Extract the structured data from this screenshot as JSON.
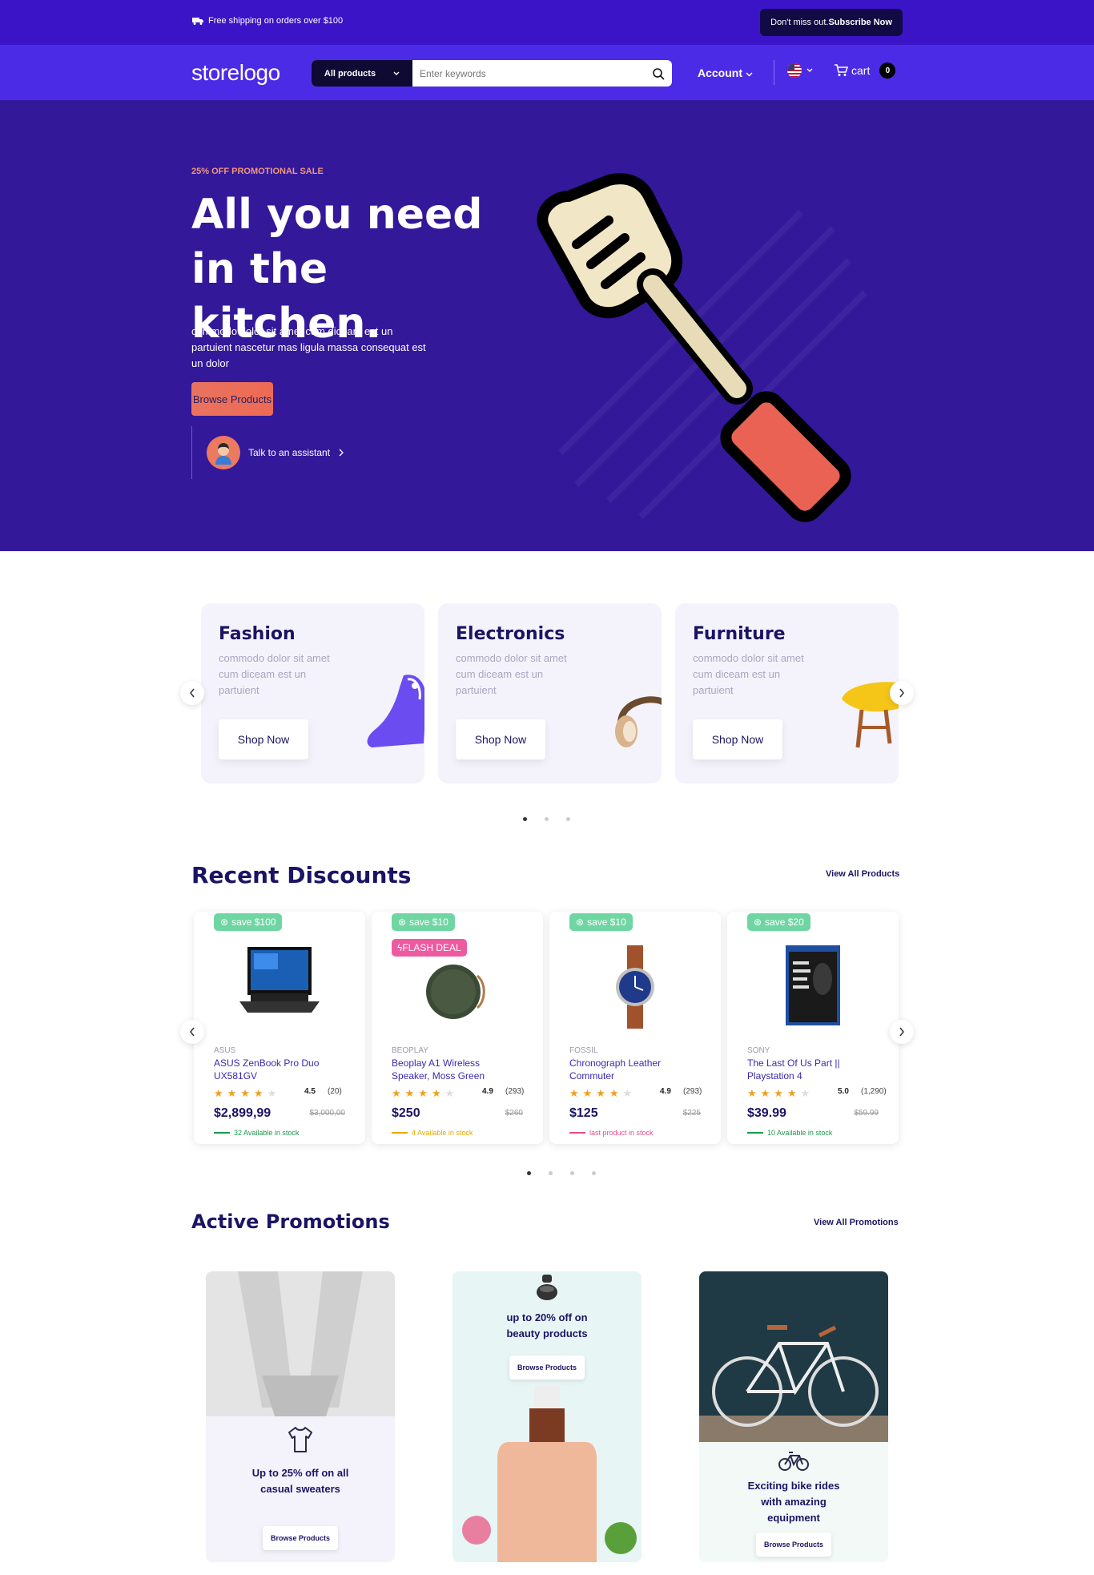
{
  "topbar": {
    "shipping": "Free shipping on orders over $100",
    "subscribe_prefix": "Don't miss out.",
    "subscribe_link": "Subscribe Now"
  },
  "nav": {
    "logo": "storelogo",
    "category": "All products",
    "search_placeholder": "Enter keywords",
    "account": "Account",
    "cart_label": "cart",
    "cart_count": "0"
  },
  "hero": {
    "promo": "25% OFF PROMOTIONAL SALE",
    "title": "All you need in the kitchen.",
    "description": "commodo dolor sit amet cum diceam est un partuient nascetur mas ligula massa consequat est un dolor",
    "button": "Browse Products",
    "assistant": "Talk to an assistant"
  },
  "categories": [
    {
      "title": "Fashion",
      "description": "commodo dolor sit amet cum diceam est un partuient",
      "button": "Shop Now"
    },
    {
      "title": "Electronics",
      "description": "commodo dolor sit amet cum diceam est un partuient",
      "button": "Shop Now"
    },
    {
      "title": "Furniture",
      "description": "commodo dolor sit amet cum diceam est un partuient",
      "button": "Shop Now"
    }
  ],
  "discounts": {
    "title": "Recent Discounts",
    "view_all": "View All Products",
    "products": [
      {
        "badge": "save $100",
        "brand": "ASUS",
        "name": "ASUS ZenBook Pro Duo UX581GV",
        "rating": "4.5",
        "stars": 4,
        "count": "(20)",
        "price": "$2,899,99",
        "old_price": "$3,000,00",
        "stock": "32 Available in stock",
        "stock_color": "#1a9a4a"
      },
      {
        "badge": "save $10",
        "flash": "FLASH DEAL",
        "brand": "BEOPLAY",
        "name": "Beoplay A1 Wireless Speaker, Moss Green",
        "rating": "4.9",
        "stars": 4,
        "count": "(293)",
        "price": "$250",
        "old_price": "$260",
        "stock": "4 Available in stock",
        "stock_color": "#e9a800"
      },
      {
        "badge": "save $10",
        "brand": "FOSSIL",
        "name": "Chronograph Leather Commuter",
        "rating": "4.9",
        "stars": 4,
        "count": "(293)",
        "price": "$125",
        "old_price": "$225",
        "stock": "last product in stock",
        "stock_color": "#e74c8a"
      },
      {
        "badge": "save $20",
        "brand": "SONY",
        "name": "The Last Of Us Part || Playstation 4",
        "rating": "5.0",
        "stars": 4,
        "count": "(1,290)",
        "price": "$39.99",
        "old_price": "$59.99",
        "stock": "10 Available in stock",
        "stock_color": "#1a9a4a"
      }
    ]
  },
  "promotions": {
    "title": "Active Promotions",
    "view_all": "View All Promotions",
    "items": [
      {
        "title": "Up to 25% off on all casual sweaters",
        "button": "Browse Products"
      },
      {
        "title": "up to 20% off on beauty products",
        "button": "Browse Products"
      },
      {
        "title": "Exciting bike rides with amazing equipment",
        "button": "Browse Products"
      }
    ]
  },
  "colors": {
    "brand": "#4b2be6",
    "hero_bg": "#33189a",
    "accent": "#ee6a55",
    "navy": "#1b1464"
  }
}
